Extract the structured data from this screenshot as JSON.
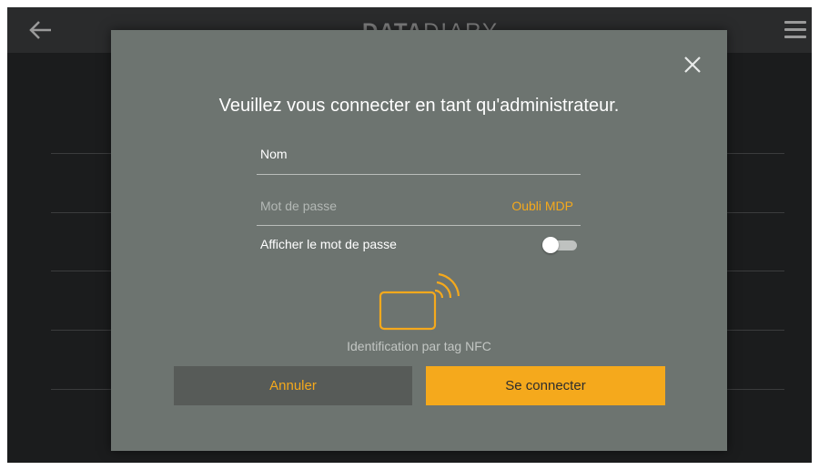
{
  "app": {
    "logo_bold": "DATA",
    "logo_light": "DIARY",
    "accent_color": "#f5a91c",
    "back_icon": "arrow-left-icon",
    "menu_icon": "hamburger-menu-icon"
  },
  "dialog": {
    "title": "Veuillez vous connecter en tant qu'administrateur.",
    "close_icon": "close-icon",
    "name_field": {
      "placeholder": "Nom",
      "value": ""
    },
    "password_field": {
      "placeholder": "Mot de passe",
      "value": ""
    },
    "forgot_link": "Oubli MDP",
    "show_password_label": "Afficher le mot de passe",
    "show_password_enabled": false,
    "nfc_icon": "nfc-card-icon",
    "nfc_label": "Identification par tag NFC",
    "cancel_label": "Annuler",
    "connect_label": "Se connecter"
  }
}
